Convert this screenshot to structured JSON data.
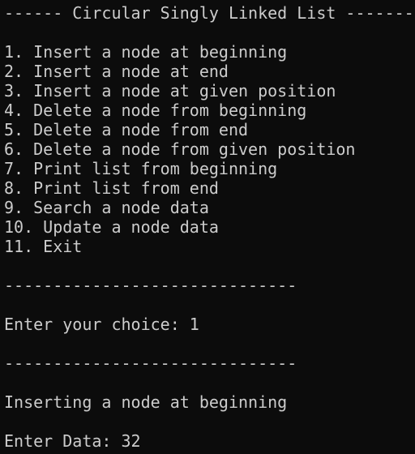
{
  "terminal": {
    "title": "------ Circular Singly Linked List -------",
    "menu": [
      "1. Insert a node at beginning",
      "2. Insert a node at end",
      "3. Insert a node at given position",
      "4. Delete a node from beginning",
      "5. Delete a node from end",
      "6. Delete a node from given position",
      "7. Print list from beginning",
      "8. Print list from end",
      "9. Search a node data",
      "10. Update a node data",
      "11. Exit"
    ],
    "separator": "------------------------------",
    "choice_prompt": "Enter your choice: ",
    "choice_value": "1",
    "status_message": "Inserting a node at beginning",
    "data_prompt": "Enter Data: ",
    "data_value": "32"
  }
}
